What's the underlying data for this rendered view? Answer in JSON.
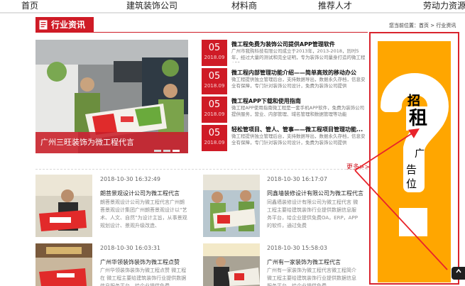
{
  "nav": {
    "items": [
      "首页",
      "建筑装饰公司",
      "材料商",
      "推荐人才",
      "劳动力资源"
    ]
  },
  "section": {
    "title": "行业资讯",
    "breadcrumb": "您当前位置：首页 > 行业资讯"
  },
  "slide": {
    "caption": "广州三旺装饰为微工程代言",
    "dots": 3,
    "active_dot": 2
  },
  "news": [
    {
      "day": "05",
      "month": "2018.09",
      "title": "微工程免费为装饰公司提供APP管理软件",
      "desc": "广州市我购科技有限公司成立于2013年，2013-2018，历时5年，经过大量的测试和完全证明，专为装饰公司量身打造的微工程APP"
    },
    {
      "day": "05",
      "month": "2018.09",
      "title": "微工程内部管理功能介绍——简单高效的移动办公",
      "desc": "微工程提供独立管理后台，支持数据导出，数据永久存档，信息安全有保障，专门针对装饰公司设计，免费为装饰公司提供"
    },
    {
      "day": "05",
      "month": "2018.09",
      "title": "微工程APP下载和使用指南",
      "desc": "微工程APP使用指南微工程是一套手机APP软件，免费为装饰公司提供服务，营业、内部管理、域名管理和数据管理等功能"
    },
    {
      "day": "05",
      "month": "2018.09",
      "title": "轻松管项目、管人、管事——微工程项目管理功能...",
      "desc": "微工程提供独立管理后台，支持数据导出，数据永久存档，信息安全有保障，专门针对装饰公司设计，免费为装饰公司提供"
    }
  ],
  "more": "更多>>",
  "cards": [
    {
      "time": "2018-10-30 16:32:49",
      "title": "朗菩景观设计公司为微工程代言",
      "desc": "朗菩景观设计公司为微工程代言广州朗菩景观设计集团广州朗菩景观设计以“艺术、人文、自然”为设计主旨，从事景观规划设计、景观升级改造、"
    },
    {
      "time": "2018-10-30 16:17:07",
      "title": "同鑫墙装修设计有限公司为微工程代言",
      "desc": "同鑫墙装修设计有限公司为微工程代言 微工程主要给建筑装饰行业提供数据信息服务平台，给企业提供免费OA，ERP，APP的软件，通过免费"
    },
    {
      "time": "2018-10-30 16:03:31",
      "title": "广州华领装饰装饰为微工程点赞",
      "desc": "广州华领装饰装饰为微工程点赞 微工程在 微工程主要给建筑装饰行业提供数据信息服务平台，给企业提供免费"
    },
    {
      "time": "2018-10-30 15:58:03",
      "title": "广州有一家装饰为微工程代言",
      "desc": "广州有一家装饰为微工程代言微工程简介 微工程主要给建筑装饰行业提供数据信息服务平台，给企业提供免费"
    }
  ],
  "ad": {
    "chars": [
      "招",
      "租",
      "广",
      "告",
      "位"
    ],
    "bg": "#ffa600",
    "border": "#d9242e"
  },
  "colors": {
    "accent": "#cf1b26"
  }
}
